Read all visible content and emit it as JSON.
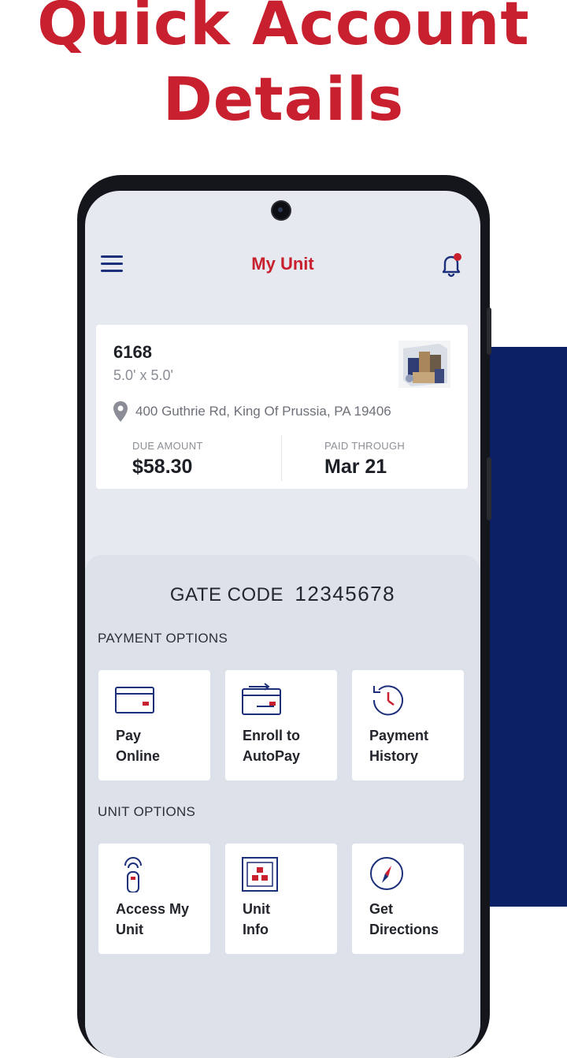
{
  "promo": {
    "title_line1": "Quick Account",
    "title_line2": "Details"
  },
  "app": {
    "title": "My Unit",
    "menu_icon": "hamburger-menu-icon",
    "notification_icon": "bell-icon"
  },
  "unit": {
    "number": "6168",
    "size": "5.0' x 5.0'",
    "address": "400 Guthrie Rd, King Of Prussia, PA 19406",
    "due_label": "DUE AMOUNT",
    "due_value": "$58.30",
    "paid_label": "PAID THROUGH",
    "paid_value": "Mar 21"
  },
  "gate": {
    "label": "GATE CODE",
    "code": "12345678"
  },
  "payment_options": {
    "heading": "PAYMENT OPTIONS",
    "tiles": [
      {
        "line1": "Pay",
        "line2": "Online",
        "icon": "credit-card-icon"
      },
      {
        "line1": "Enroll to",
        "line2": "AutoPay",
        "icon": "autopay-card-icon"
      },
      {
        "line1": "Payment",
        "line2": "History",
        "icon": "history-clock-icon"
      }
    ]
  },
  "unit_options": {
    "heading": "UNIT OPTIONS",
    "tiles": [
      {
        "line1": "Access My",
        "line2": "Unit",
        "icon": "remote-access-icon"
      },
      {
        "line1": "Unit",
        "line2": "Info",
        "icon": "unit-info-icon"
      },
      {
        "line1": "Get",
        "line2": "Directions",
        "icon": "compass-icon"
      }
    ]
  },
  "colors": {
    "brand_red": "#c8202e",
    "brand_navy": "#0c2066",
    "icon_blue": "#1c2f7a"
  }
}
